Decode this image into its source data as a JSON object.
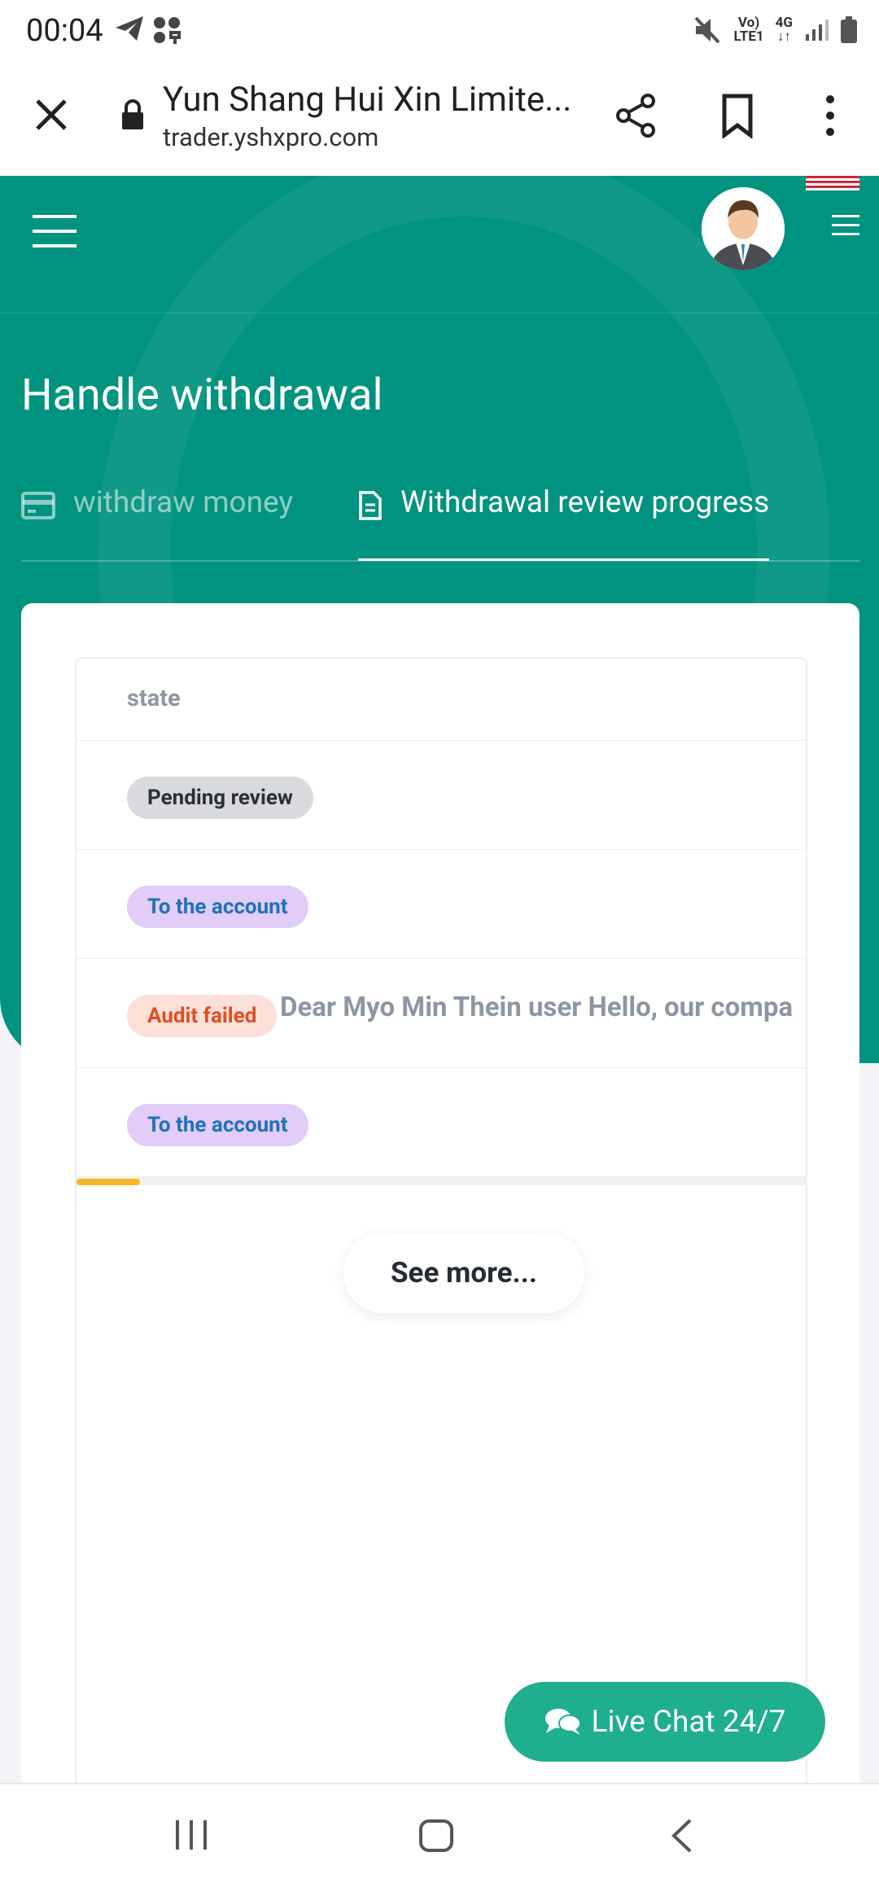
{
  "status_bar": {
    "time": "00:04",
    "network_top": "Vo)",
    "network_bottom": "LTE1",
    "signal_label": "4G"
  },
  "browser": {
    "title": "Yun Shang Hui Xin Limite...",
    "url": "trader.yshxpro.com"
  },
  "page": {
    "title": "Handle withdrawal",
    "tabs": [
      {
        "label": "withdraw money",
        "active": false
      },
      {
        "label": "Withdrawal review progress",
        "active": true
      }
    ]
  },
  "table": {
    "header": "state",
    "rows": [
      {
        "status": "Pending review",
        "message": ""
      },
      {
        "status": "To the account",
        "message": ""
      },
      {
        "status": "Audit failed",
        "message": "Dear Myo Min Thein user Hello, our compa"
      },
      {
        "status": "To the account",
        "message": ""
      }
    ],
    "see_more": "See more..."
  },
  "live_chat": {
    "label": "Live Chat 24/7"
  },
  "colors": {
    "primary": "#00937f",
    "chat": "#1fae8e",
    "scroll_thumb": "#f6b626"
  }
}
